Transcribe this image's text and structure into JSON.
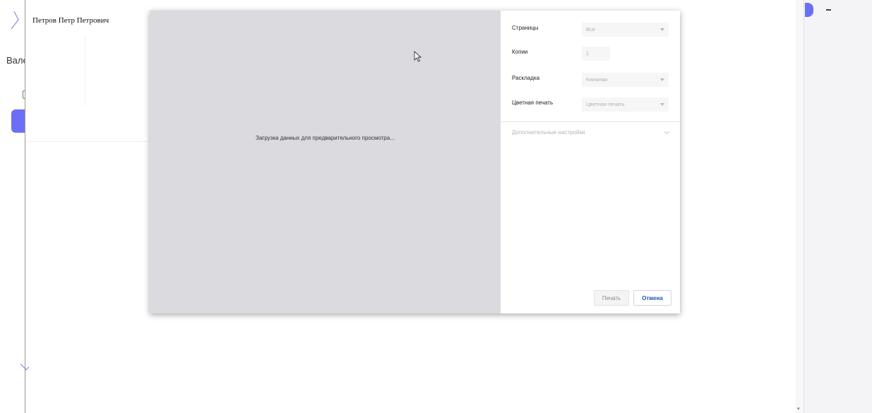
{
  "background": {
    "person_name": "Петров Петр Петрович",
    "partial_label": "Вале"
  },
  "dialog": {
    "preview_message": "Загрузка данных для предварительного просмотра...",
    "settings": {
      "pages": {
        "label": "Страницы",
        "value": "Все"
      },
      "copies": {
        "label": "Копии",
        "value": "1"
      },
      "layout": {
        "label": "Раскладка",
        "value": "Книжная"
      },
      "color_print": {
        "label": "Цветная печать",
        "value": "Цветная печать"
      },
      "advanced": {
        "label": "Дополнительные настройки"
      }
    },
    "buttons": {
      "print": "Печать",
      "cancel": "Отмена"
    }
  },
  "colors": {
    "accent": "#6b6ff5",
    "cancel_text": "#1a57a8",
    "preview_bg": "#dadadf"
  },
  "icons": [
    "chevron-right-icon",
    "document-icon",
    "dropdown-caret-icon",
    "chevron-down-icon",
    "mouse-cursor-icon"
  ]
}
